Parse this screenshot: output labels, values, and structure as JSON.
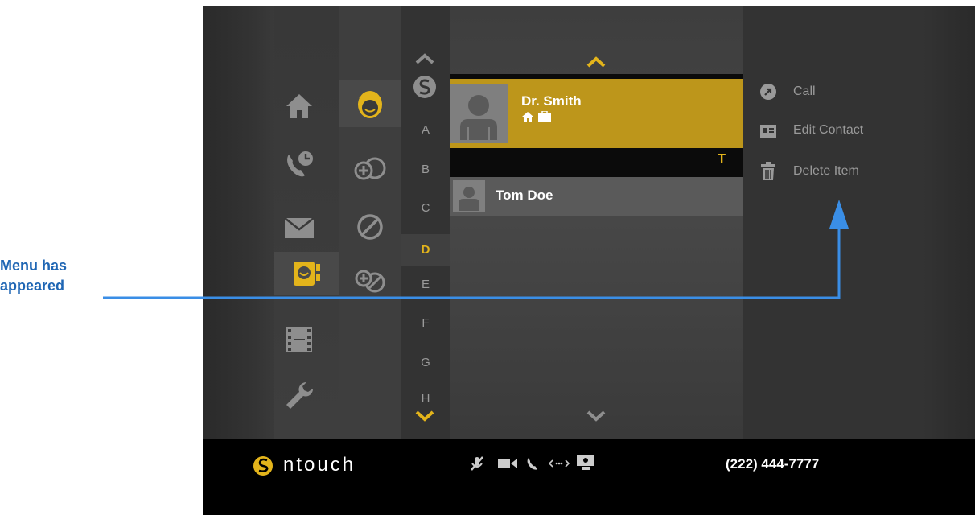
{
  "annotation": {
    "line1": "Menu has",
    "line2": "appeared"
  },
  "nav": {
    "items": [
      "home-icon",
      "call-history-icon",
      "mail-icon",
      "contacts-icon",
      "videos-icon",
      "settings-icon"
    ],
    "selected": "contacts-icon"
  },
  "sub_nav": {
    "items": [
      "contact-face-icon",
      "add-contact-icon",
      "block-icon",
      "add-block-icon"
    ],
    "selected": "contact-face-icon"
  },
  "alphabet": {
    "letters": [
      "A",
      "B",
      "C",
      "D",
      "E",
      "F",
      "G",
      "H"
    ],
    "active": "D"
  },
  "contacts": {
    "selected": {
      "name": "Dr. Smith",
      "badges": [
        "home-icon",
        "work-icon"
      ]
    },
    "section_letter": "T",
    "other": {
      "name": "Tom Doe"
    }
  },
  "menu": {
    "call": "Call",
    "edit": "Edit Contact",
    "delete": "Delete Item"
  },
  "bottom_bar": {
    "brand": "ntouch",
    "phone": "(222) 444-7777"
  },
  "colors": {
    "accent": "#e3b41b",
    "selected_row": "#bd961b",
    "annotation": "#1f66b4"
  }
}
